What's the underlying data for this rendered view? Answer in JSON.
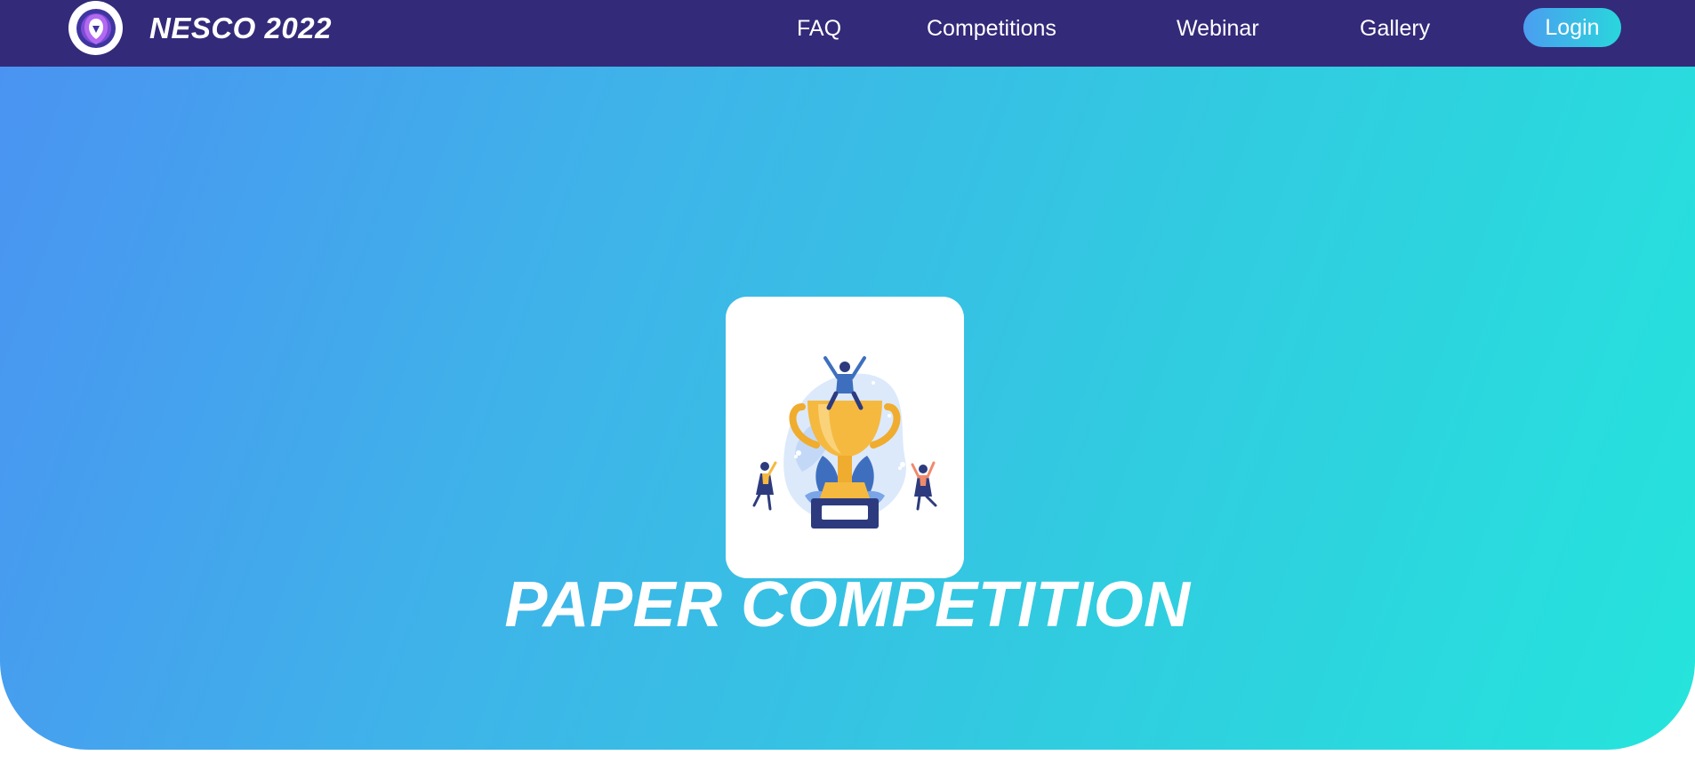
{
  "header": {
    "brand_name": "NESCO 2022",
    "logo_icon": "nesco-shield-logo",
    "nav": [
      {
        "label": "FAQ"
      },
      {
        "label": "Competitions"
      },
      {
        "label": "Webinar"
      },
      {
        "label": "Gallery"
      }
    ],
    "login_label": "Login"
  },
  "hero": {
    "illustration": "trophy-celebration-illustration",
    "title": "PAPER COMPETITION"
  },
  "colors": {
    "navbar": "#332a7a",
    "accent_start": "#4b9ef0",
    "accent_end": "#29d6dc",
    "trophy": "#f5b940",
    "text": "#ffffff"
  }
}
